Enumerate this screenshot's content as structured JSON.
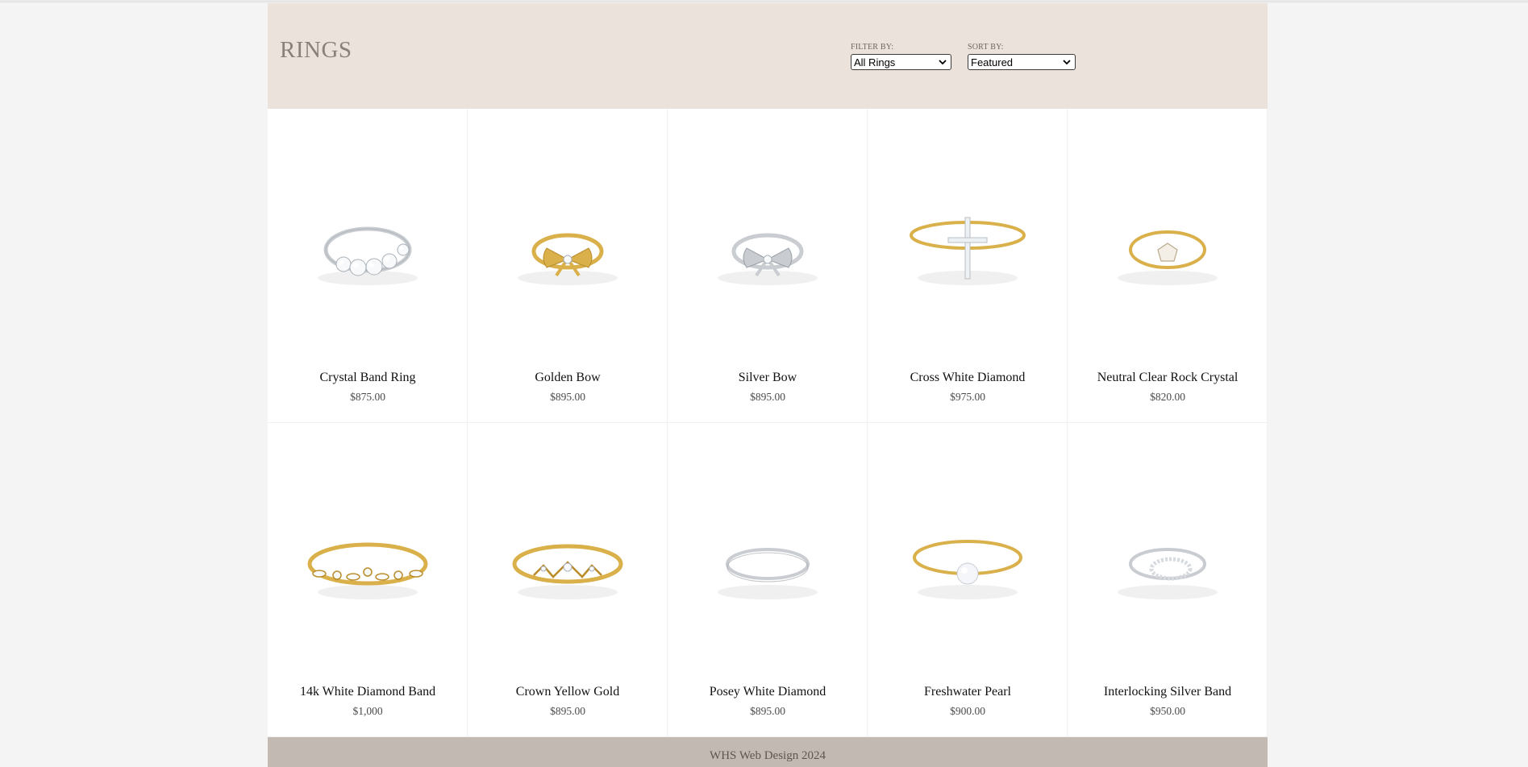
{
  "header": {
    "title": "RINGS",
    "filter": {
      "label": "FILTER BY:",
      "value": "All Rings"
    },
    "sort": {
      "label": "SORT BY:",
      "value": "Featured"
    }
  },
  "products": [
    {
      "name": "Crystal Band Ring",
      "price": "$875.00",
      "metal": "silver",
      "style": "crystal-band",
      "icon": "crystal-band-ring-icon"
    },
    {
      "name": "Golden Bow",
      "price": "$895.00",
      "metal": "gold",
      "style": "bow",
      "icon": "golden-bow-ring-icon"
    },
    {
      "name": "Silver Bow",
      "price": "$895.00",
      "metal": "silver",
      "style": "bow",
      "icon": "silver-bow-ring-icon"
    },
    {
      "name": "Cross White Diamond",
      "price": "$975.00",
      "metal": "gold",
      "style": "cross",
      "icon": "cross-ring-icon"
    },
    {
      "name": "Neutral Clear Rock Crystal",
      "price": "$820.00",
      "metal": "gold",
      "style": "solitaire",
      "icon": "rock-crystal-ring-icon"
    },
    {
      "name": "14k White Diamond Band",
      "price": "$1,000",
      "metal": "gold",
      "style": "marquise-band",
      "icon": "diamond-band-ring-icon"
    },
    {
      "name": "Crown Yellow Gold",
      "price": "$895.00",
      "metal": "gold",
      "style": "crown",
      "icon": "crown-ring-icon"
    },
    {
      "name": "Posey White Diamond",
      "price": "$895.00",
      "metal": "silver",
      "style": "thin-band",
      "icon": "posey-ring-icon"
    },
    {
      "name": "Freshwater Pearl",
      "price": "$900.00",
      "metal": "gold",
      "style": "pearl",
      "icon": "pearl-ring-icon"
    },
    {
      "name": "Interlocking Silver Band",
      "price": "$950.00",
      "metal": "silver",
      "style": "interlock",
      "icon": "interlocking-ring-icon"
    }
  ],
  "colors": {
    "header_bg": "#ebe3db",
    "footer_bg": "#c2bab2",
    "gold": "#d9b04a",
    "silver": "#c9cdd2"
  },
  "footer": {
    "text": "WHS Web Design 2024"
  }
}
